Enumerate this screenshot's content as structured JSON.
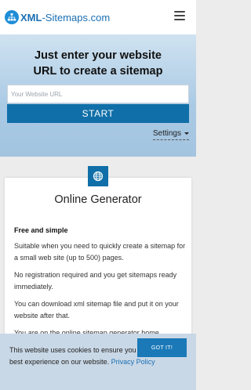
{
  "header": {
    "logo_bold": "XML",
    "logo_rest": "-Sitemaps.com"
  },
  "hero": {
    "title_line1": "Just enter your website",
    "title_line2": "URL to create a sitemap",
    "url_placeholder": "Your Website URL",
    "url_value": "",
    "start_label": "START",
    "settings_label": "Settings"
  },
  "card": {
    "title": "Online Generator",
    "subtitle": "Free and simple",
    "paragraphs": [
      "Suitable when you need to quickly create a sitemap for a small web site (up to 500) pages.",
      "No registration required and you get sitemaps ready immediately.",
      "You can download xml sitemap file and put it on your website after that.",
      "You are on the online sitemap generator home"
    ]
  },
  "cookie": {
    "text": "This website uses cookies to ensure you get the best experience on our website.",
    "link_label": "Privacy Policy",
    "button_label": "GOT IT!"
  },
  "colors": {
    "brand_blue": "#106fa8",
    "logo_blue": "#1a6fb3",
    "hero_gradient_top": "#cfe2f0",
    "cookie_bg": "#c9d8e6"
  },
  "icons": [
    "sitemap-logo-icon",
    "hamburger-menu-icon",
    "caret-down-icon",
    "globe-icon"
  ]
}
